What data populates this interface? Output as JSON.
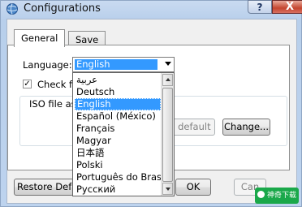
{
  "window": {
    "title": "Configurations",
    "help_label": "?",
    "close_label": "X"
  },
  "tabs": [
    {
      "label": "General",
      "active": true
    },
    {
      "label": "Save",
      "active": false
    }
  ],
  "general": {
    "language_label": "Language:",
    "language_value": "English",
    "check_label": "Check fo",
    "iso_label": "ISO file as",
    "default_button": "e default",
    "change_button": "Change..."
  },
  "language_options": [
    "عربية",
    "Deutsch",
    "English",
    "Español (México)",
    "Français",
    "Magyar",
    "日本語",
    "Polski",
    "Português do Brasil",
    "Русский"
  ],
  "selected_option": "English",
  "footer": {
    "restore_label": "Restore Defa",
    "ok_label": "OK",
    "cancel_label": "Can"
  },
  "watermark": {
    "text": "神奇下载"
  },
  "colors": {
    "selection": "#3399ff",
    "close_button": "#c4452f",
    "watermark": "#1aa84a"
  }
}
